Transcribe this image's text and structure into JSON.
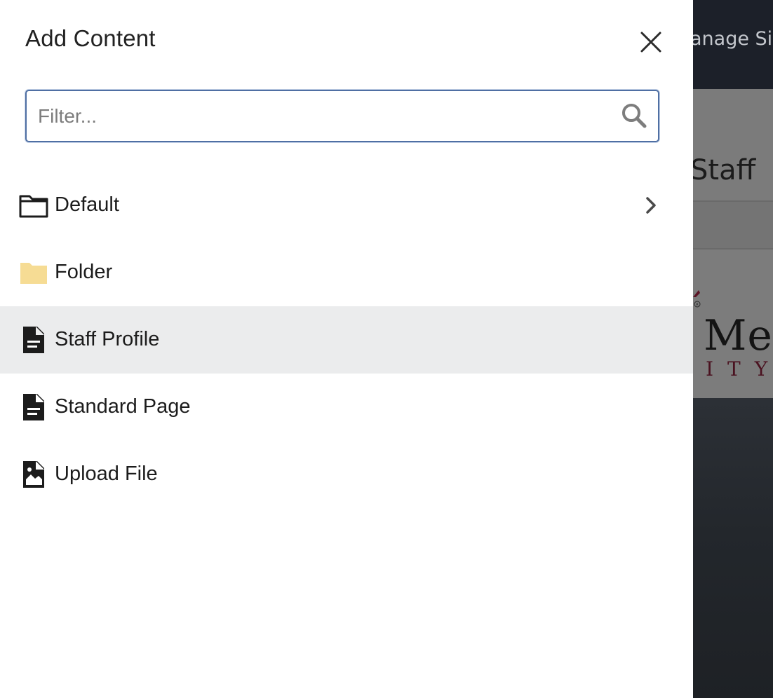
{
  "background_page": {
    "topbar_text": "anage Si",
    "title_fragment": "Staff",
    "logo_fragment": "Mes",
    "logo_subtext": "ITY"
  },
  "panel": {
    "title": "Add Content",
    "close_icon": "close-icon",
    "filter": {
      "placeholder": "Filter...",
      "value": "",
      "icon": "search-icon"
    },
    "items": [
      {
        "label": "Default",
        "icon": "folder-outline-icon",
        "has_children": true,
        "highlighted": false
      },
      {
        "label": "Folder",
        "icon": "folder-filled-icon",
        "has_children": false,
        "highlighted": false
      },
      {
        "label": "Staff Profile",
        "icon": "document-icon",
        "has_children": false,
        "highlighted": true
      },
      {
        "label": "Standard Page",
        "icon": "document-icon",
        "has_children": false,
        "highlighted": false
      },
      {
        "label": "Upload File",
        "icon": "image-file-icon",
        "has_children": false,
        "highlighted": false
      }
    ]
  },
  "colors": {
    "folder_fill": "#f6dc94",
    "highlight_row": "#ebeced",
    "filter_border": "#4f6fa3",
    "topbar_dark": "#1c2029"
  }
}
